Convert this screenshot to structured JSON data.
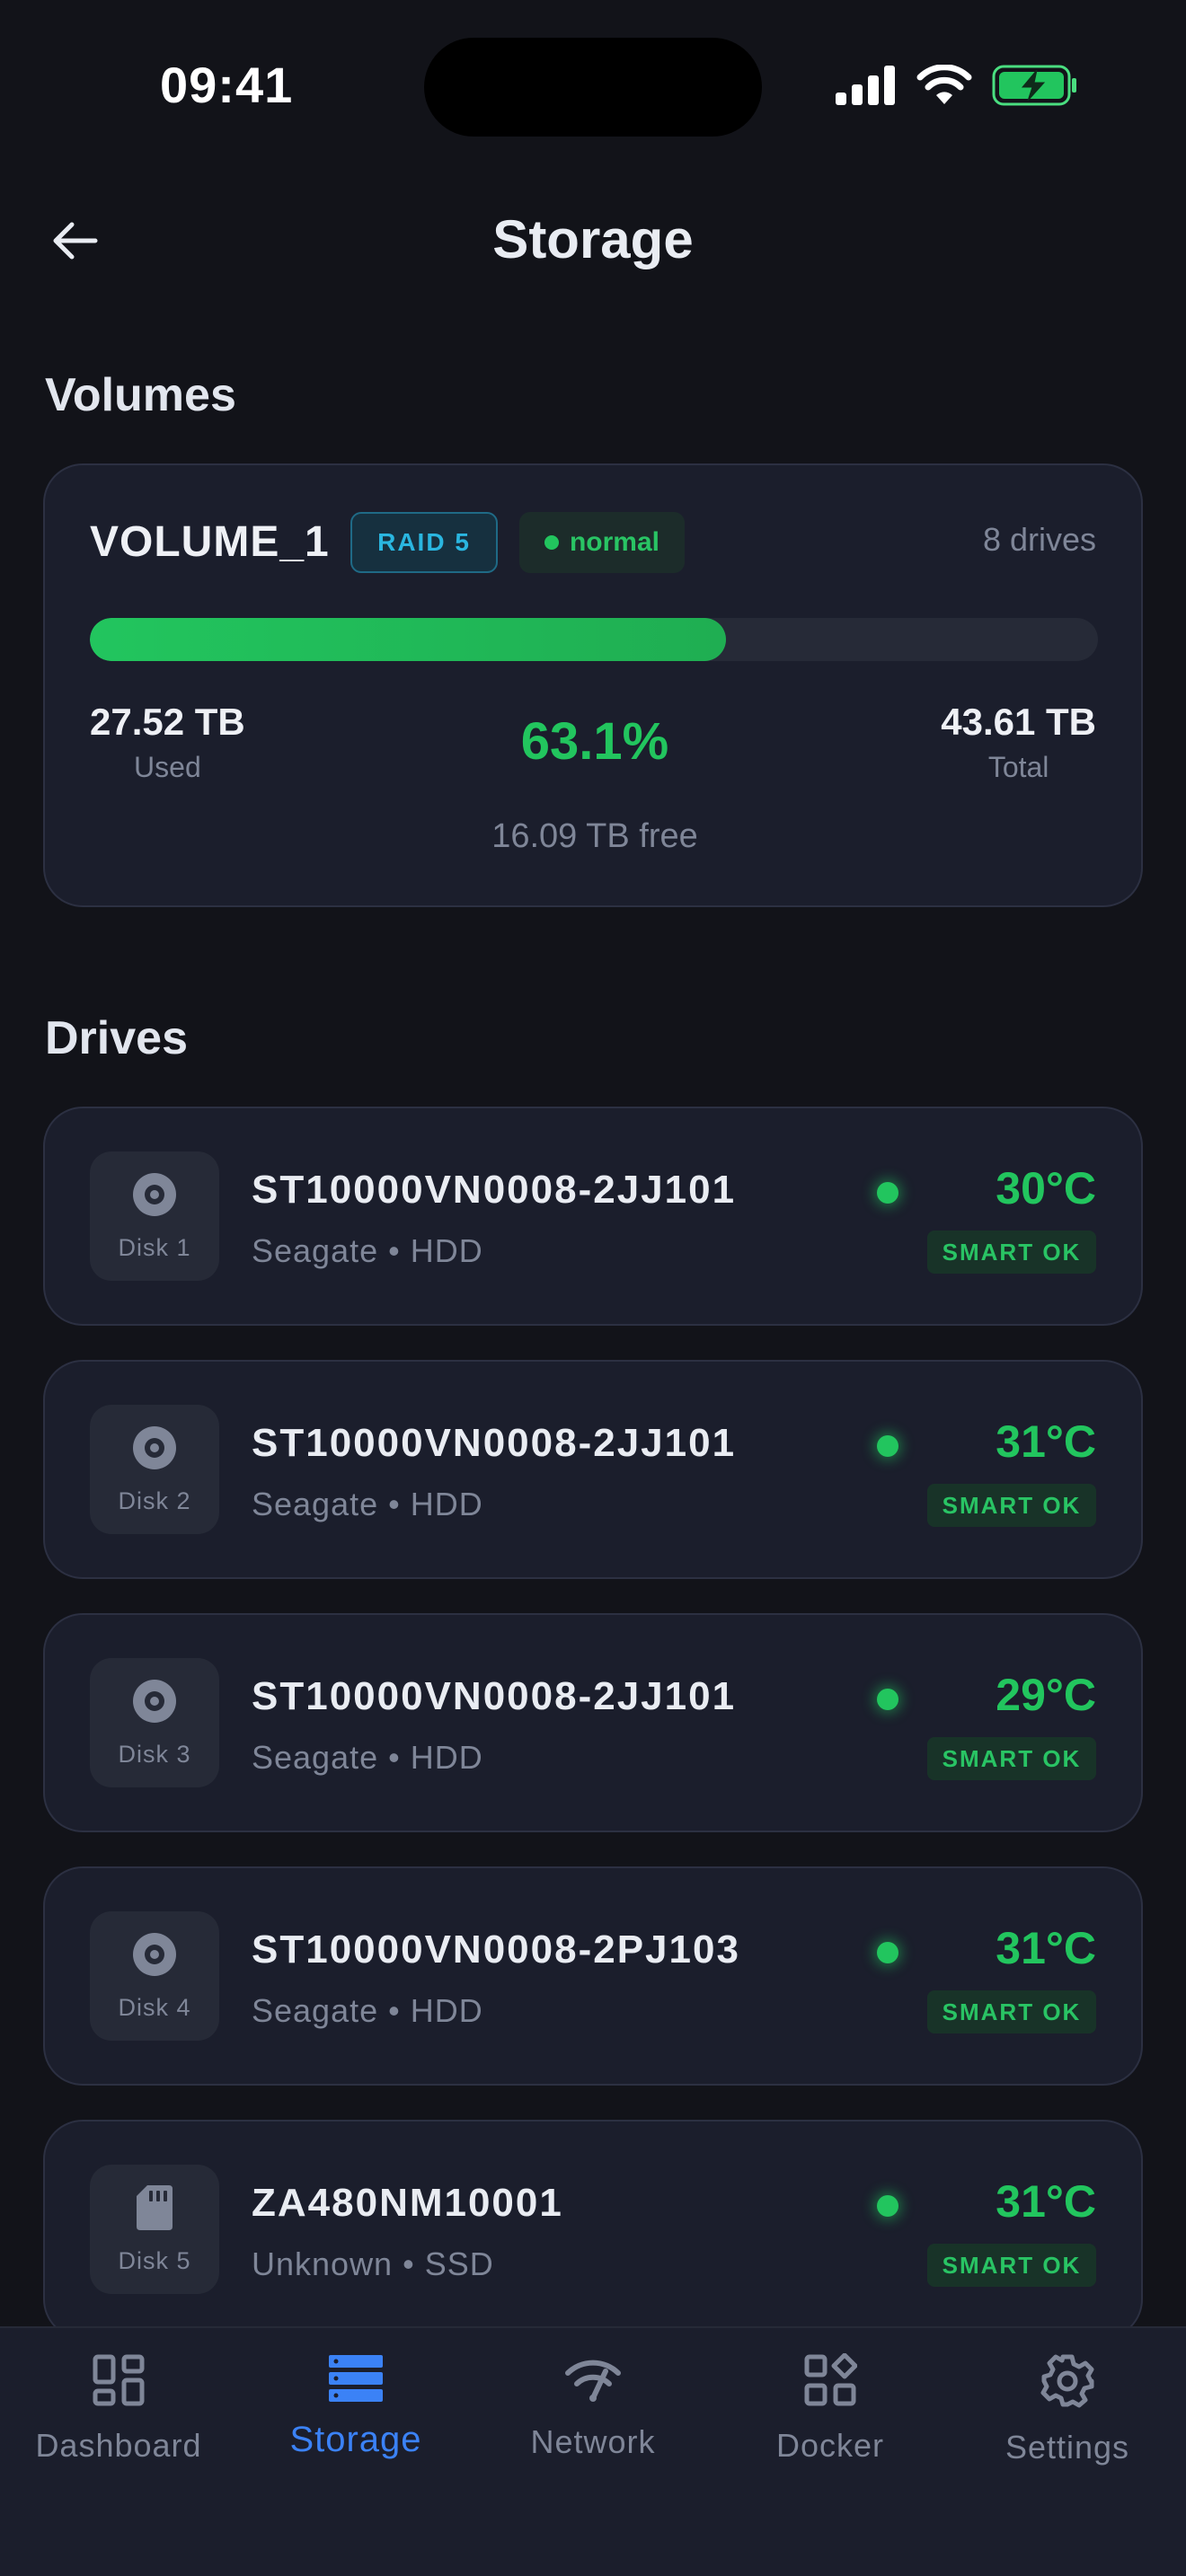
{
  "status_bar": {
    "time": "09:41"
  },
  "header": {
    "title": "Storage"
  },
  "volumes_section": {
    "title": "Volumes"
  },
  "volume": {
    "name": "VOLUME_1",
    "raid": "RAID 5",
    "status": "normal",
    "drives": "8 drives",
    "used_fraction": 0.631,
    "used_value": "27.52 TB",
    "used_label": "Used",
    "percent": "63.1%",
    "total_value": "43.61 TB",
    "total_label": "Total",
    "free": "16.09 TB free"
  },
  "drives_section": {
    "title": "Drives"
  },
  "drives": [
    {
      "disk": "Disk 1",
      "model": "ST10000VN0008-2JJ101",
      "sub": "Seagate • HDD",
      "temp": "30°C",
      "smart": "SMART OK",
      "icon": "hdd-icon"
    },
    {
      "disk": "Disk 2",
      "model": "ST10000VN0008-2JJ101",
      "sub": "Seagate • HDD",
      "temp": "31°C",
      "smart": "SMART OK",
      "icon": "hdd-icon"
    },
    {
      "disk": "Disk 3",
      "model": "ST10000VN0008-2JJ101",
      "sub": "Seagate • HDD",
      "temp": "29°C",
      "smart": "SMART OK",
      "icon": "hdd-icon"
    },
    {
      "disk": "Disk 4",
      "model": "ST10000VN0008-2PJ103",
      "sub": "Seagate • HDD",
      "temp": "31°C",
      "smart": "SMART OK",
      "icon": "hdd-icon"
    },
    {
      "disk": "Disk 5",
      "model": "ZA480NM10001",
      "sub": "Unknown • SSD",
      "temp": "31°C",
      "smart": "SMART OK",
      "icon": "ssd-icon"
    }
  ],
  "tabs": [
    {
      "label": "Dashboard",
      "icon": "dashboard-icon",
      "active": false
    },
    {
      "label": "Storage",
      "icon": "storage-icon",
      "active": true
    },
    {
      "label": "Network",
      "icon": "network-icon",
      "active": false
    },
    {
      "label": "Docker",
      "icon": "docker-icon",
      "active": false
    },
    {
      "label": "Settings",
      "icon": "gear-icon",
      "active": false
    }
  ],
  "colors": {
    "accent": "#3b82f6",
    "ok": "#22c55e",
    "raid": "#2ab6e0",
    "background": "#121319",
    "card": "#1b1e2c"
  }
}
